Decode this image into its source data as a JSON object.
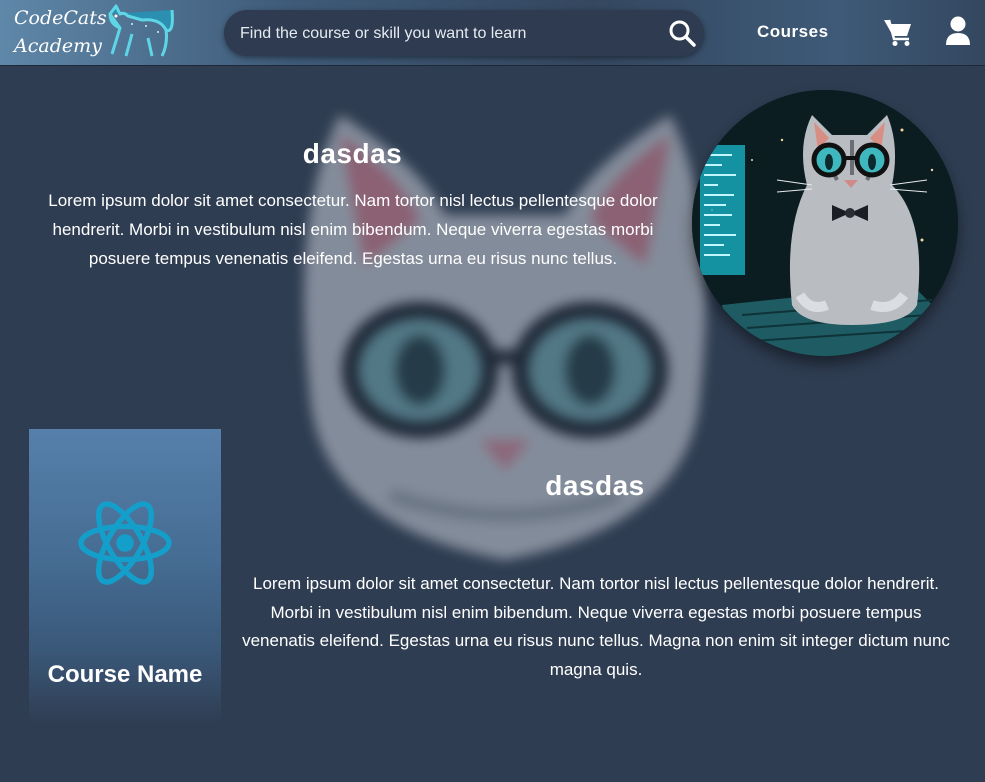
{
  "brand": {
    "logo_line1": "CodeCats",
    "logo_line2": "Academy",
    "logo_icon": "cat-icon"
  },
  "search": {
    "placeholder": "Find the course or skill you want to learn",
    "icon": "search-icon"
  },
  "nav": {
    "courses_label": "Courses",
    "cart_icon": "cart-icon",
    "user_icon": "user-icon"
  },
  "hero": {
    "title": "dasdas",
    "text": "Lorem ipsum dolor sit amet consectetur. Nam tortor nisl lectus pellentesque dolor hendrerit. Morbi in vestibulum nisl enim bibendum. Neque viverra egestas morbi posuere tempus venenatis eleifend. Egestas urna eu risus nunc tellus."
  },
  "course": {
    "card_icon": "react-icon",
    "card_name": "Course Name",
    "title": "dasdas",
    "description": "Lorem ipsum dolor sit amet consectetur. Nam tortor nisl lectus pellentesque dolor hendrerit. Morbi in vestibulum nisl enim bibendum. Neque viverra egestas morbi posuere tempus venenatis eleifend. Egestas urna eu risus nunc tellus. Magna non enim sit integer dictum nunc magna quis."
  },
  "colors": {
    "background": "#2f3d52",
    "react_blue": "#149eca",
    "card_top": "#5680ab"
  }
}
